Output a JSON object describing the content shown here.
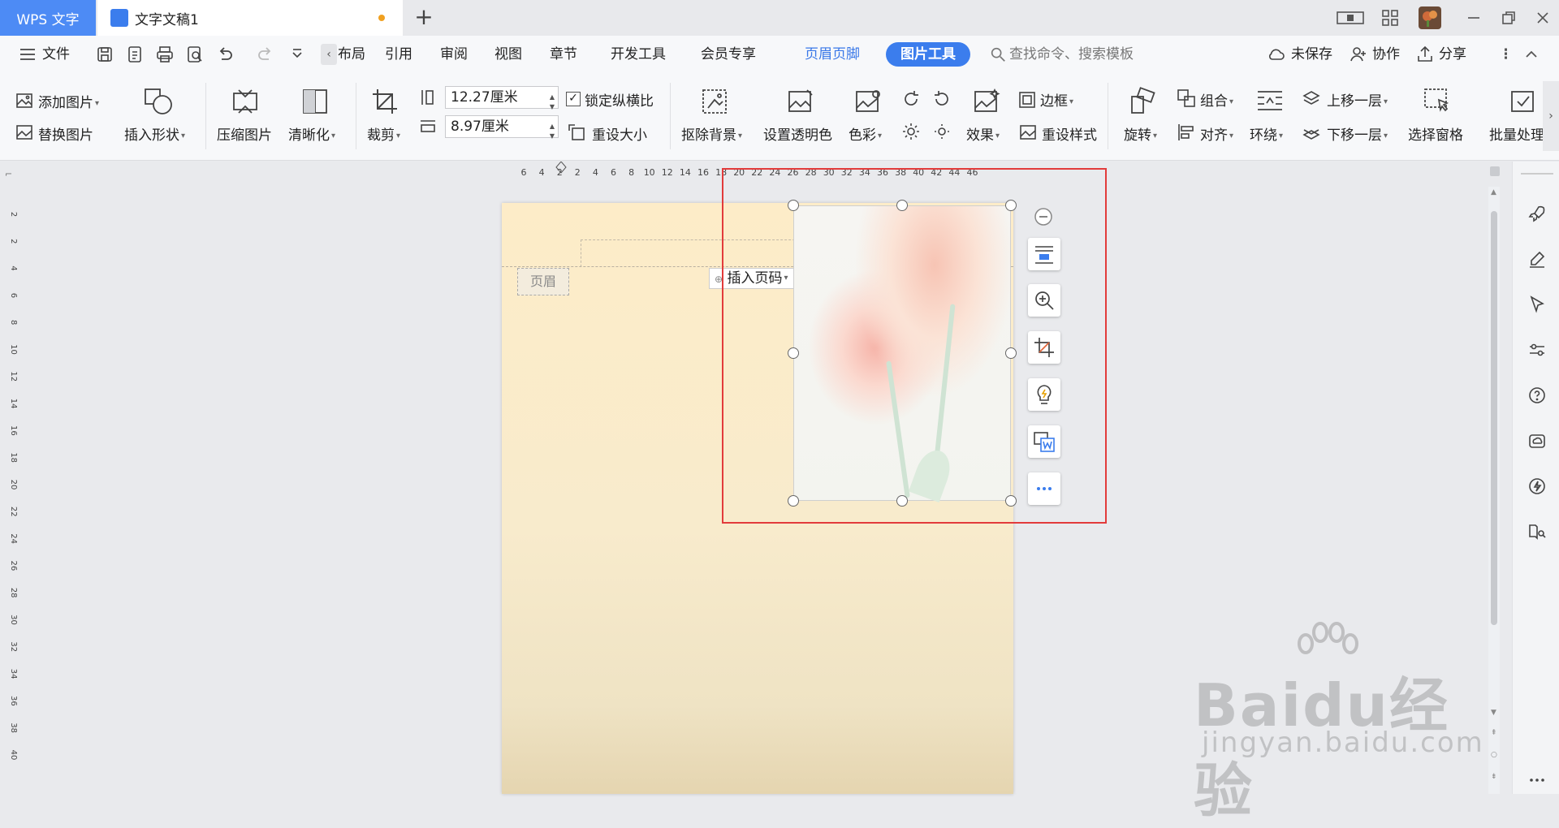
{
  "titlebar": {
    "app_tab": "WPS 文字",
    "doc_tab": "文字文稿1",
    "new_tab_symbol": "+"
  },
  "menubar": {
    "file": "文件",
    "tabs": [
      "布局",
      "引用",
      "审阅",
      "视图",
      "章节",
      "开发工具",
      "会员专享",
      "页眉页脚"
    ],
    "active_tab": "图片工具",
    "search_placeholder": "查找命令、搜索模板",
    "unsaved": "未保存",
    "collab": "协作",
    "share": "分享"
  },
  "ribbon": {
    "add_image": "添加图片",
    "replace_image": "替换图片",
    "insert_shape": "插入形状",
    "compress_image": "压缩图片",
    "sharpen": "清晰化",
    "crop": "裁剪",
    "height_value": "12.27厘米",
    "width_value": "8.97厘米",
    "lock_ratio": "锁定纵横比",
    "reset_size": "重设大小",
    "remove_bg": "抠除背景",
    "set_transparent": "设置透明色",
    "color": "色彩",
    "effects": "效果",
    "border": "边框",
    "reset_style": "重设样式",
    "rotate": "旋转",
    "group": "组合",
    "align": "对齐",
    "wrap": "环绕",
    "bring_forward": "上移一层",
    "send_backward": "下移一层",
    "selection_pane": "选择窗格",
    "batch": "批量处理"
  },
  "ruler": {
    "h_ticks": [
      "6",
      "4",
      "2",
      "2",
      "4",
      "6",
      "8",
      "10",
      "12",
      "14",
      "16",
      "18",
      "20",
      "22",
      "24",
      "26",
      "28",
      "30",
      "32",
      "34",
      "36",
      "38",
      "40",
      "42",
      "44",
      "46"
    ],
    "v_ticks": [
      "2",
      "2",
      "4",
      "6",
      "8",
      "10",
      "12",
      "14",
      "16",
      "18",
      "20",
      "22",
      "24",
      "26",
      "28",
      "30",
      "32",
      "34",
      "36",
      "38",
      "40"
    ]
  },
  "document": {
    "header_label": "页眉",
    "insert_page_number": "插入页码"
  },
  "watermark": {
    "main": "Baidu经验",
    "sub": "jingyan.baidu.com"
  },
  "colors": {
    "accent": "#3b7ded",
    "highlight": "#e23b3b"
  }
}
